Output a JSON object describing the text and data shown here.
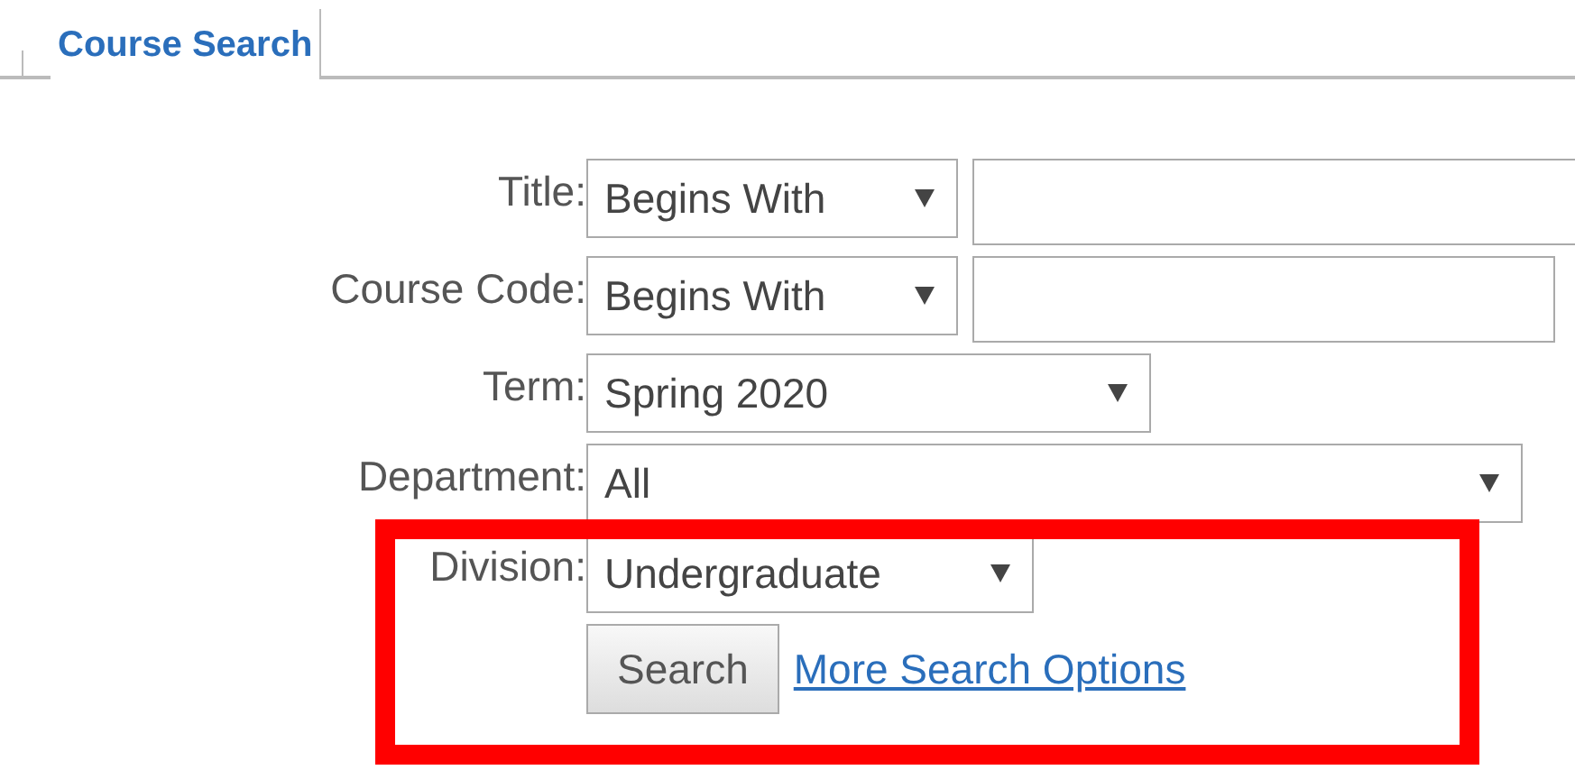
{
  "tabs": [
    {
      "label": "Course Search",
      "selected": true
    }
  ],
  "form": {
    "rows": [
      {
        "label": "Title:",
        "controls": [
          {
            "kind": "select",
            "value": "Begins With"
          },
          {
            "kind": "input"
          }
        ]
      },
      {
        "label": "Course Code:",
        "controls": [
          {
            "kind": "select",
            "value": "Begins With"
          },
          {
            "kind": "input"
          }
        ]
      },
      {
        "label": "Term:",
        "controls": [
          {
            "kind": "select",
            "value": "Spring 2020"
          }
        ]
      },
      {
        "label": "Department:",
        "controls": [
          {
            "kind": "select",
            "value": "All"
          }
        ]
      },
      {
        "label": "Division:",
        "controls": [
          {
            "kind": "select",
            "value": "Undergraduate"
          }
        ]
      }
    ],
    "search_button": "Search",
    "more_options_link": "More Search Options"
  },
  "annotation": {
    "kind": "highlight-box",
    "color": "#ff0000"
  }
}
